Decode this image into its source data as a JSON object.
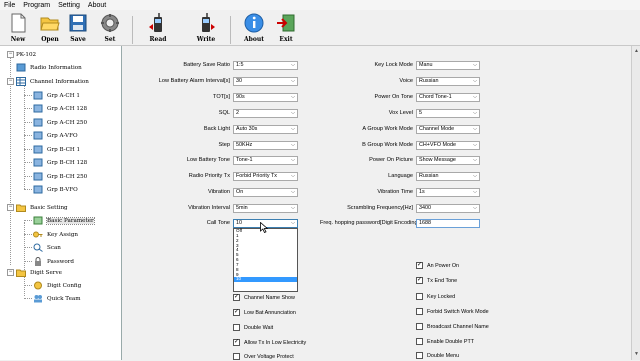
{
  "menu": [
    "File",
    "Program",
    "Setting",
    "About"
  ],
  "toolbar": {
    "new": "New",
    "open": "Open",
    "save": "Save",
    "set": "Set",
    "read": "Read",
    "write": "Write",
    "about": "About",
    "exit": "Exit"
  },
  "tree": {
    "root": "PK-102",
    "radio_info": "Radio Information",
    "channel_info": "Channel Information",
    "channels": [
      "Grp A-CH 1",
      "Grp A-CH 128",
      "Grp A-CH 250",
      "Grp A-VFO",
      "Grp B-CH 1",
      "Grp B-CH 128",
      "Grp B-CH 250",
      "Grp B-VFO"
    ],
    "basic_setting": "Basic Setting",
    "basic_items": [
      "Basic Parameter",
      "Key Assign",
      "Scan",
      "Password"
    ],
    "digit_serve": "Digit Serve",
    "digit_items": [
      "Digit Config",
      "Quick Team"
    ]
  },
  "left_fields": [
    {
      "label": "Battery Save Ratio",
      "value": "1:5"
    },
    {
      "label": "Low Battery Alarm Interval[s]",
      "value": "30"
    },
    {
      "label": "TOT[s]",
      "value": "90s"
    },
    {
      "label": "SQL",
      "value": "2"
    },
    {
      "label": "Back Light",
      "value": "Auto 30s"
    },
    {
      "label": "Step",
      "value": "50KHz"
    },
    {
      "label": "Low Battery Tone",
      "value": "Tone-1"
    },
    {
      "label": "Radio Priority Tx",
      "value": "Forbid Priority Tx"
    },
    {
      "label": "Vibration",
      "value": "On"
    },
    {
      "label": "Vibration Interval",
      "value": "5min"
    },
    {
      "label": "Call Tone",
      "value": "10"
    }
  ],
  "right_fields": [
    {
      "label": "Key Lock Mode",
      "value": "Manu"
    },
    {
      "label": "Voice",
      "value": "Russian"
    },
    {
      "label": "Power On Tone",
      "value": "Chord Tone-1"
    },
    {
      "label": "Vox Level",
      "value": "5"
    },
    {
      "label": "A Group Work Mode",
      "value": "Channel Mode"
    },
    {
      "label": "B Group Work Mode",
      "value": "CH+VFO Mode"
    },
    {
      "label": "Power On Picture",
      "value": "Show Message"
    },
    {
      "label": "Language",
      "value": "Russian"
    },
    {
      "label": "Vibration Time",
      "value": "1s"
    },
    {
      "label": "Scrambling Frequency[Hz]",
      "value": "3400"
    }
  ],
  "freq_hop": {
    "label": "Freq. hopping password[Digit Encoding]",
    "value": "1688"
  },
  "call_tone_options": [
    "Off",
    "1",
    "2",
    "3",
    "4",
    "5",
    "6",
    "7",
    "8",
    "9",
    "10"
  ],
  "call_tone_selected": "10",
  "left_checks": [
    {
      "label": "Channel Name Show",
      "checked": true
    },
    {
      "label": "Low Bat Annunciation",
      "checked": true
    },
    {
      "label": "Double Wait",
      "checked": false
    },
    {
      "label": "Allow Tx In Low Electricity",
      "checked": true
    },
    {
      "label": "Over Voltage Protect",
      "checked": false
    }
  ],
  "right_checks": [
    {
      "label": "An Power On",
      "checked": true
    },
    {
      "label": "Tx End Tone",
      "checked": true
    },
    {
      "label": "Key Locked",
      "checked": false
    },
    {
      "label": "Forbid Switch Work Mode",
      "checked": false
    },
    {
      "label": "Broadcast Channel Name",
      "checked": false
    },
    {
      "label": "Enable Double PTT",
      "checked": false
    },
    {
      "label": "Double Menu",
      "checked": false
    }
  ],
  "colors": {
    "accent": "#3399ff",
    "tree_bg": "#ffffff",
    "window_bg": "#f0f0f0"
  }
}
